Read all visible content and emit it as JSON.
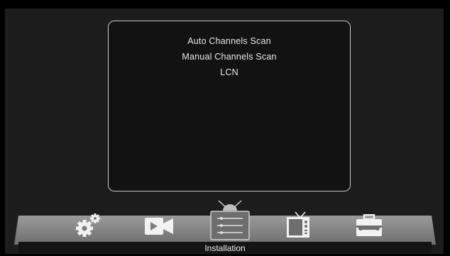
{
  "menu": {
    "items": [
      "Auto Channels Scan",
      "Manual Channels Scan",
      "LCN"
    ]
  },
  "dock": {
    "selected_label": "Installation",
    "icons": [
      "gears-icon",
      "video-camera-icon",
      "tv-list-icon",
      "tv-set-icon",
      "toolbox-icon"
    ]
  },
  "colors": {
    "background": "#000000",
    "panel": "#121212",
    "panel_border": "#c8c8c8",
    "dock": "#8a8a8a",
    "text": "#e8e8e8"
  }
}
